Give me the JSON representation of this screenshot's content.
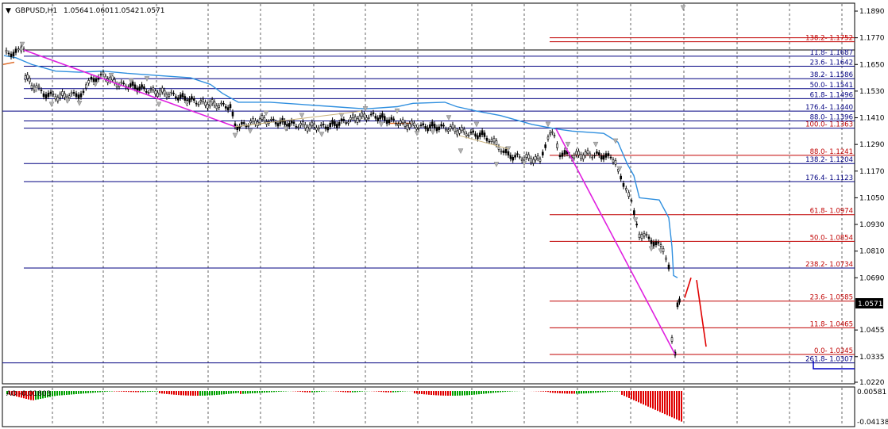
{
  "header": {
    "menu_arrow": "▼",
    "symbol": "GBPUSD,H1",
    "open": "1.0564",
    "high": "1.0601",
    "low": "1.0542",
    "close": "1.0571"
  },
  "price_axis": {
    "ticks": [
      "1.1890",
      "1.1770",
      "1.1650",
      "1.1530",
      "1.1410",
      "1.1290",
      "1.1170",
      "1.1050",
      "1.0930",
      "1.0810",
      "1.0690",
      "1.0571",
      "1.0455",
      "1.0335",
      "1.0220"
    ],
    "current_price": "1.0571"
  },
  "oscillator": {
    "label": "AO -0.01803",
    "ticks": [
      "0.00581",
      "-0.04138"
    ]
  },
  "fib_red": [
    {
      "label": "138.2- 1.1752",
      "price": 1.1752
    },
    {
      "label": "100.0- 1.1363",
      "price": 1.1363
    },
    {
      "label": "88.0- 1.1241",
      "price": 1.1241
    },
    {
      "label": "61.8- 1.0974",
      "price": 1.0974
    },
    {
      "label": "50.0- 1.0854",
      "price": 1.0854
    },
    {
      "label": "238.2- 1.0734",
      "price": 1.0734
    },
    {
      "label": "23.6- 1.0585",
      "price": 1.0585
    },
    {
      "label": "11.8- 1.0465",
      "price": 1.0465
    },
    {
      "label": "0.0- 1.0345",
      "price": 1.0345
    }
  ],
  "fib_navy": [
    {
      "label": "11.8- 1.1687",
      "price": 1.1687
    },
    {
      "label": "23.6- 1.1642",
      "price": 1.1642
    },
    {
      "label": "38.2- 1.1586",
      "price": 1.1586
    },
    {
      "label": "50.0- 1.1541",
      "price": 1.1541
    },
    {
      "label": "61.8- 1.1496",
      "price": 1.1496
    },
    {
      "label": "176.4- 1.1440",
      "price": 1.144
    },
    {
      "label": "88.0- 1.1396",
      "price": 1.1396
    },
    {
      "label": "138.2- 1.1204",
      "price": 1.1204
    },
    {
      "label": "176.4- 1.1123",
      "price": 1.1123
    },
    {
      "label": "261.8- 1.0307",
      "price": 1.0307
    }
  ],
  "colors": {
    "fib_red": "#c00000",
    "fib_navy": "#000080",
    "trend_magenta": "#e020e0",
    "ma_blue": "#2f8fdf",
    "ao_green": "#00a000",
    "ao_red": "#e00000",
    "forecast_red": "#e00000"
  }
}
